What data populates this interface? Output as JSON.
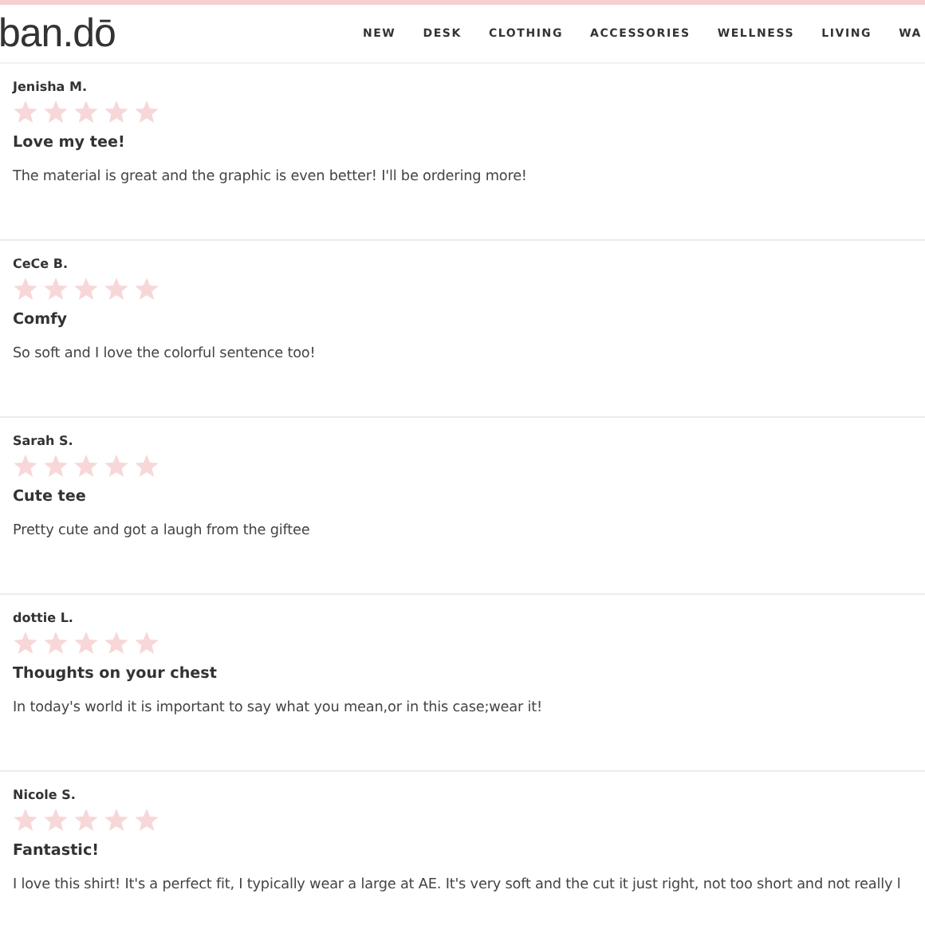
{
  "header": {
    "logo": "ban.dō",
    "nav": [
      {
        "label": "NEW"
      },
      {
        "label": "DESK"
      },
      {
        "label": "CLOTHING"
      },
      {
        "label": "ACCESSORIES"
      },
      {
        "label": "WELLNESS"
      },
      {
        "label": "LIVING"
      },
      {
        "label": "WA"
      }
    ]
  },
  "reviews": [
    {
      "author": "Jenisha M.",
      "stars": 5,
      "title": "Love my tee!",
      "body": "The material is great and the graphic is even better! I'll be ordering more!"
    },
    {
      "author": "CeCe B.",
      "stars": 5,
      "title": "Comfy",
      "body": "So soft and I love the colorful sentence too!"
    },
    {
      "author": "Sarah S.",
      "stars": 5,
      "title": "Cute tee",
      "body": "Pretty cute and got a laugh from the giftee"
    },
    {
      "author": "dottie L.",
      "stars": 5,
      "title": "Thoughts on your chest",
      "body": "In today's world it is important to say what you mean,or in this case;wear it!"
    },
    {
      "author": "Nicole S.",
      "stars": 5,
      "title": "Fantastic!",
      "body": "I love this shirt! It's a perfect fit, I typically wear a large at AE. It's very soft and the cut it just right, not too short and not really l"
    }
  ]
}
